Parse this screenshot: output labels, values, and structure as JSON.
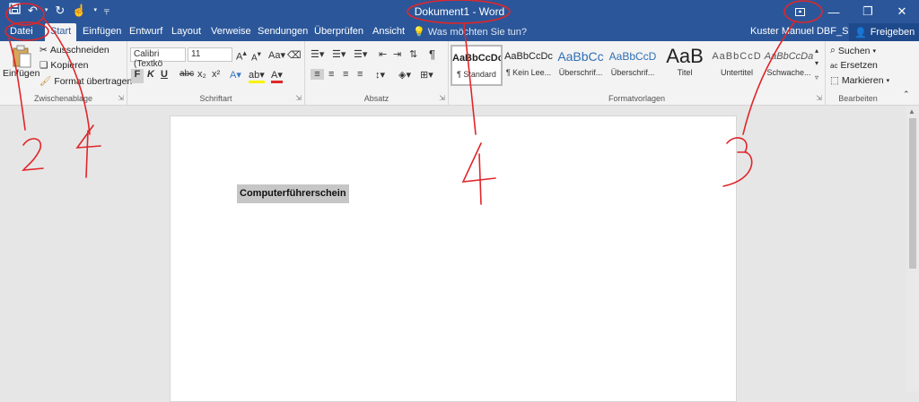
{
  "window": {
    "title": "Dokument1 - Word",
    "qat": {
      "save_icon": "save-icon",
      "undo_icon": "undo-icon",
      "redo_icon": "redo-icon",
      "touch_icon": "touch-mode-icon",
      "customize_icon": "customize-qat-icon"
    },
    "buttons": [
      "ribbon-display-options",
      "minimize",
      "restore",
      "close"
    ]
  },
  "tabs": [
    "Datei",
    "Start",
    "Einfügen",
    "Entwurf",
    "Layout",
    "Verweise",
    "Sendungen",
    "Überprüfen",
    "Ansicht"
  ],
  "active_tab": "Start",
  "tell_me": "Was möchten Sie tun?",
  "user": "Kuster Manuel DBF_SUM",
  "share": "Freigeben",
  "clipboard": {
    "paste": "Einfügen",
    "cut": "Ausschneiden",
    "copy": "Kopieren",
    "format_painter": "Format übertragen",
    "label": "Zwischenablage"
  },
  "font": {
    "name": "Calibri (Textkö",
    "size": "11",
    "bold": "F",
    "italic": "K",
    "underline": "U",
    "strike": "abc",
    "subscript": "x₂",
    "superscript": "x²",
    "label": "Schriftart"
  },
  "paragraph": {
    "pilcrow": "¶",
    "label": "Absatz"
  },
  "styles": {
    "items": [
      {
        "preview": "AaBbCcDc",
        "name": "¶ Standard",
        "selected": true
      },
      {
        "preview": "AaBbCcDc",
        "name": "¶ Kein Lee..."
      },
      {
        "preview": "AaBbCc",
        "name": "Überschrif..."
      },
      {
        "preview": "AaBbCcD",
        "name": "Überschrif..."
      },
      {
        "preview": "AaB",
        "name": "Titel"
      },
      {
        "preview": "AaBbCcD",
        "name": "Untertitel"
      },
      {
        "preview": "AaBbCcDa",
        "name": "Schwache..."
      }
    ],
    "label": "Formatvorlagen"
  },
  "editing": {
    "find": "Suchen",
    "replace": "Ersetzen",
    "select": "Markieren",
    "label": "Bearbeiten"
  },
  "document": {
    "text": "Computerführerschein"
  },
  "annotations": [
    "1",
    "2",
    "3",
    "4"
  ],
  "colors": {
    "word_blue": "#2b579a",
    "annotation_red": "#e0262a"
  }
}
